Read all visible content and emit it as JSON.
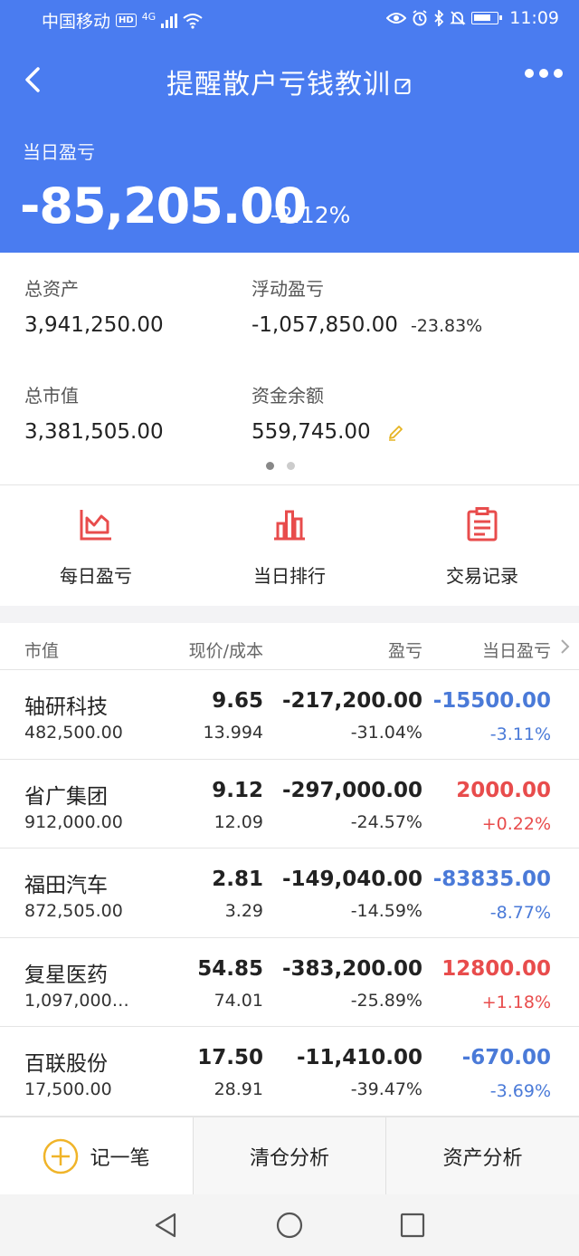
{
  "status_bar": {
    "carrier": "中国移动",
    "hd": "HD",
    "network": "4G",
    "time": "11:09"
  },
  "nav": {
    "title": "提醒散户亏钱教训"
  },
  "daily_pnl": {
    "label": "当日盈亏",
    "value": "-85,205.00",
    "pct": "-2.12%"
  },
  "summary": {
    "total_assets": {
      "label": "总资产",
      "value": "3,941,250.00"
    },
    "floating_pnl": {
      "label": "浮动盈亏",
      "value": "-1,057,850.00",
      "pct": "-23.83%"
    },
    "market_value": {
      "label": "总市值",
      "value": "3,381,505.00"
    },
    "cash_balance": {
      "label": "资金余额",
      "value": "559,745.00"
    }
  },
  "quick_actions": [
    {
      "label": "每日盈亏",
      "icon": "area-chart-icon"
    },
    {
      "label": "当日排行",
      "icon": "bar-chart-icon"
    },
    {
      "label": "交易记录",
      "icon": "clipboard-icon"
    }
  ],
  "table": {
    "headers": {
      "market_value": "市值",
      "price_cost": "现价/成本",
      "pnl": "盈亏",
      "daily_pnl": "当日盈亏"
    },
    "rows": [
      {
        "name": "轴研科技",
        "mv": "482,500.00",
        "price": "9.65",
        "cost": "13.994",
        "pnl": "-217,200.00",
        "pnl_pct": "-31.04%",
        "day": "-15500.00",
        "day_pct": "-3.11%",
        "dir": "neg"
      },
      {
        "name": "省广集团",
        "mv": "912,000.00",
        "price": "9.12",
        "cost": "12.09",
        "pnl": "-297,000.00",
        "pnl_pct": "-24.57%",
        "day": "2000.00",
        "day_pct": "+0.22%",
        "dir": "pos"
      },
      {
        "name": "福田汽车",
        "mv": "872,505.00",
        "price": "2.81",
        "cost": "3.29",
        "pnl": "-149,040.00",
        "pnl_pct": "-14.59%",
        "day": "-83835.00",
        "day_pct": "-8.77%",
        "dir": "neg"
      },
      {
        "name": "复星医药",
        "mv": "1,097,000....",
        "price": "54.85",
        "cost": "74.01",
        "pnl": "-383,200.00",
        "pnl_pct": "-25.89%",
        "day": "12800.00",
        "day_pct": "+1.18%",
        "dir": "pos"
      },
      {
        "name": "百联股份",
        "mv": "17,500.00",
        "price": "17.50",
        "cost": "28.91",
        "pnl": "-11,410.00",
        "pnl_pct": "-39.47%",
        "day": "-670.00",
        "day_pct": "-3.69%",
        "dir": "neg"
      }
    ]
  },
  "tabbar": {
    "record": "记一笔",
    "clearance": "清仓分析",
    "asset": "资产分析"
  },
  "colors": {
    "primary": "#4a7cf0",
    "negative": "#4a7ad8",
    "positive": "#e84c4c",
    "icon_red": "#e84c4c",
    "pencil": "#e6b422",
    "plus": "#f0b429"
  }
}
